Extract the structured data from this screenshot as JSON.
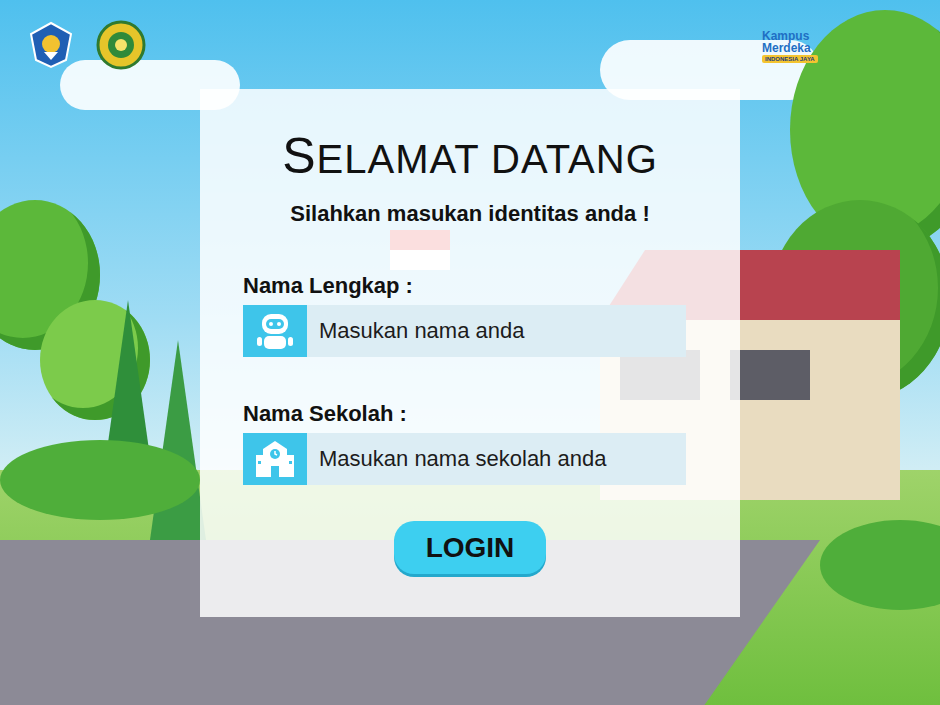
{
  "logos": {
    "kampus_merdeka": {
      "line1": "Kampus",
      "line2": "Merdeka",
      "tagline": "INDONESIA JAYA"
    }
  },
  "form": {
    "title": "SELAMAT DATANG",
    "subtitle": "Silahkan masukan identitas anda !",
    "fields": [
      {
        "label": "Nama Lengkap :",
        "placeholder": "Masukan nama anda",
        "kind": "person"
      },
      {
        "label": "Nama Sekolah :",
        "placeholder": "Masukan nama sekolah anda",
        "kind": "school"
      }
    ],
    "button": "LOGIN"
  }
}
